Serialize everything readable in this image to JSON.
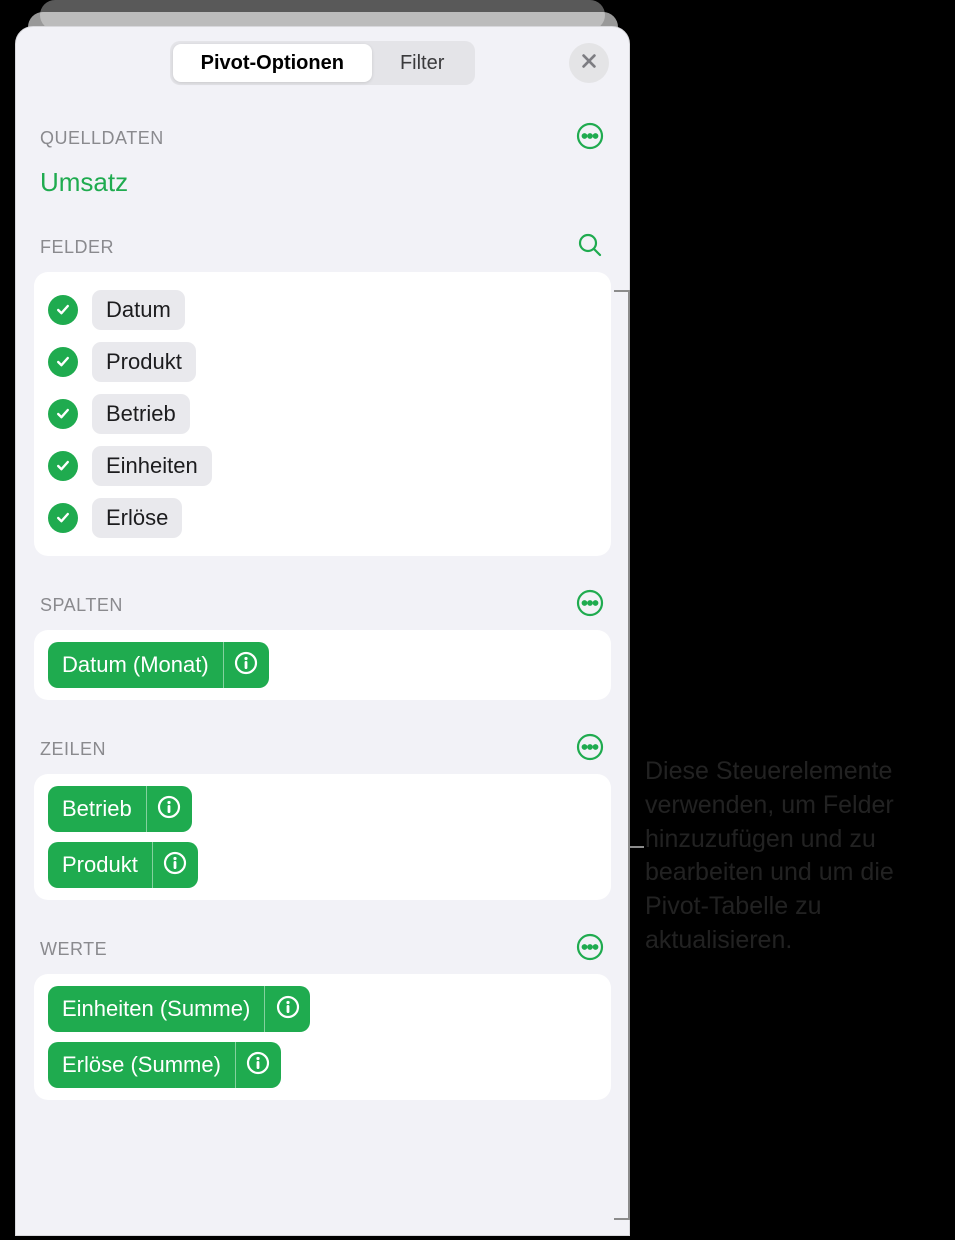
{
  "tabs": {
    "left": "Pivot-Optionen",
    "right": "Filter"
  },
  "sections": {
    "source": {
      "title": "QUELLDATEN",
      "name": "Umsatz"
    },
    "fields": {
      "title": "FELDER",
      "items": [
        "Datum",
        "Produkt",
        "Betrieb",
        "Einheiten",
        "Erlöse"
      ]
    },
    "columns": {
      "title": "SPALTEN",
      "items": [
        "Datum (Monat)"
      ]
    },
    "rows": {
      "title": "ZEILEN",
      "items": [
        "Betrieb",
        "Produkt"
      ]
    },
    "values": {
      "title": "WERTE",
      "items": [
        "Einheiten (Summe)",
        "Erlöse (Summe)"
      ]
    }
  },
  "callout": "Diese Steuerelemente verwenden, um Felder hinzuzufügen und zu bearbeiten und um die Pivot-Tabelle zu aktualisieren."
}
